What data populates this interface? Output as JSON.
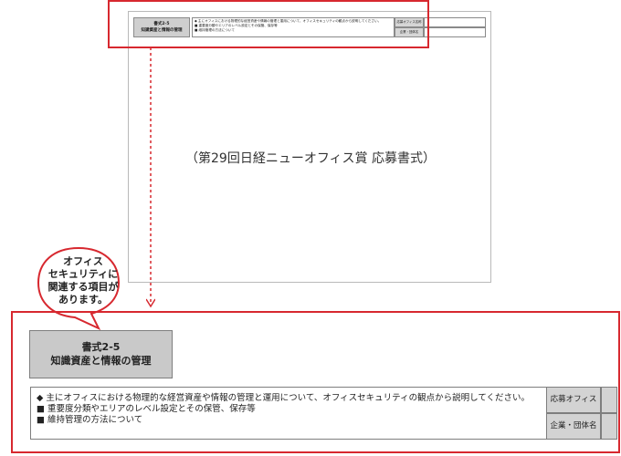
{
  "thumbnail": {
    "title_line1": "書式2-5",
    "title_line2": "知識資産と情報の管理",
    "bullet_main": "◆ 主にオフィスにおける物理的な経営資産や情報の管理と運用について、オフィスセキュリティの観点から説明してください。",
    "bullet_1": "■ 重要度分類やエリアのレベル設定とその保管、保存等",
    "bullet_2": "■ 維持管理の方法について",
    "label_1": "応募オフィス名称",
    "label_2": "企業・団体名",
    "caption": "（第29回日経ニューオフィス賞 応募書式）"
  },
  "callout": {
    "line1": "オフィス",
    "line2": "セキュリティに",
    "line3": "関連する項目が",
    "line4": "あります。"
  },
  "detail": {
    "title_line1": "書式2-5",
    "title_line2": "知識資産と情報の管理",
    "bullet_main": "◆ 主にオフィスにおける物理的な経営資産や情報の管理と運用について、オフィスセキュリティの観点から説明してください。",
    "bullet_1": "■ 重要度分類やエリアのレベル設定とその保管、保存等",
    "bullet_2": "■ 維持管理の方法について",
    "label_1": "応募オフィス名称",
    "label_2": "企業・団体名"
  },
  "colors": {
    "highlight": "#d7282f",
    "label_fill": "#d3d3d3",
    "title_fill": "#c9c9c9"
  }
}
